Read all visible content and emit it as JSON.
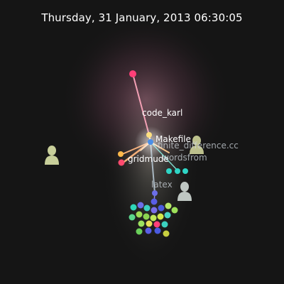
{
  "title": "Thursday, 31 January, 2013 06:30:05",
  "labels": {
    "code_karl": "code_karl",
    "makefile": "Makefile",
    "finite_difference": "finite_difference.cc",
    "gridmude": "gridmude",
    "wordsfrom": "wordsfrom",
    "latex": "latex"
  },
  "colors": {
    "background": "#151515",
    "pink_glow": "#b06b86",
    "edge_pink": "#f2a0b4",
    "edge_orange": "#f6b07a",
    "edge_teal": "#7fd8cc",
    "edge_gray": "#a7b5bf",
    "user_avatar": "#c8cf9a",
    "user_avatar_gray": "#bfc7c3"
  },
  "icons": [
    "user-avatar-icon"
  ]
}
